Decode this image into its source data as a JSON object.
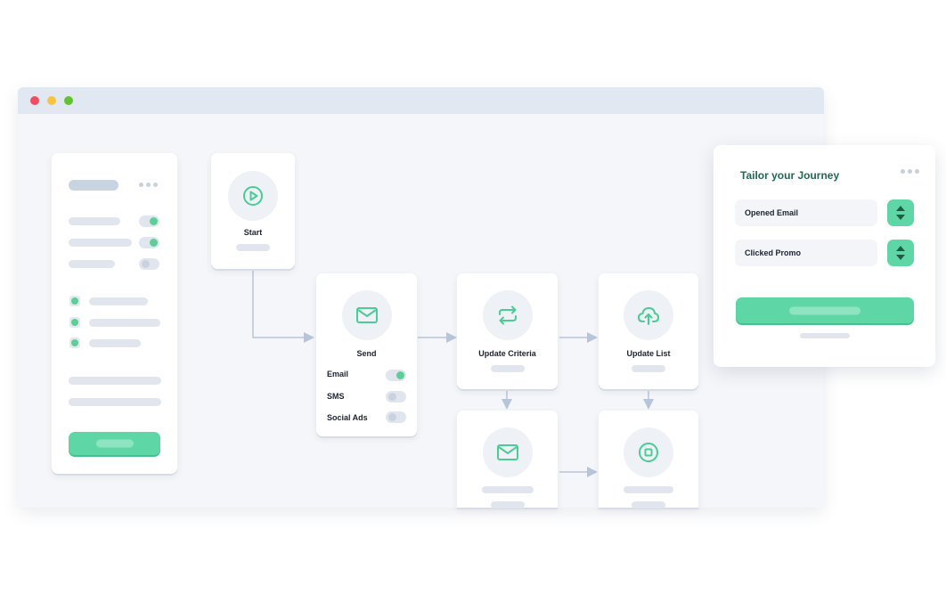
{
  "window": {
    "controls": [
      "close",
      "minimize",
      "maximize"
    ]
  },
  "sidebar": {
    "toggles": [
      true,
      true,
      false
    ],
    "checkboxes": [
      true,
      true,
      true
    ]
  },
  "nodes": {
    "start": {
      "label": "Start",
      "icon": "play-icon"
    },
    "send": {
      "label": "Send",
      "icon": "mail-icon",
      "channels": [
        {
          "label": "Email",
          "on": true
        },
        {
          "label": "SMS",
          "on": false
        },
        {
          "label": "Social Ads",
          "on": false
        }
      ]
    },
    "update_criteria": {
      "label": "Update Criteria",
      "icon": "repeat-icon"
    },
    "update_list": {
      "label": "Update List",
      "icon": "cloud-upload-icon"
    },
    "email_step": {
      "icon": "mail-icon"
    },
    "stop_step": {
      "icon": "stop-icon"
    }
  },
  "panel": {
    "title": "Tailor your Journey",
    "fields": [
      {
        "label": "Opened Email"
      },
      {
        "label": "Clicked Promo"
      }
    ]
  },
  "colors": {
    "accent": "#5ed6a6",
    "accent_dark": "#1f6a4e",
    "icon": "#4ccb94",
    "connector": "#b6c6d8"
  }
}
